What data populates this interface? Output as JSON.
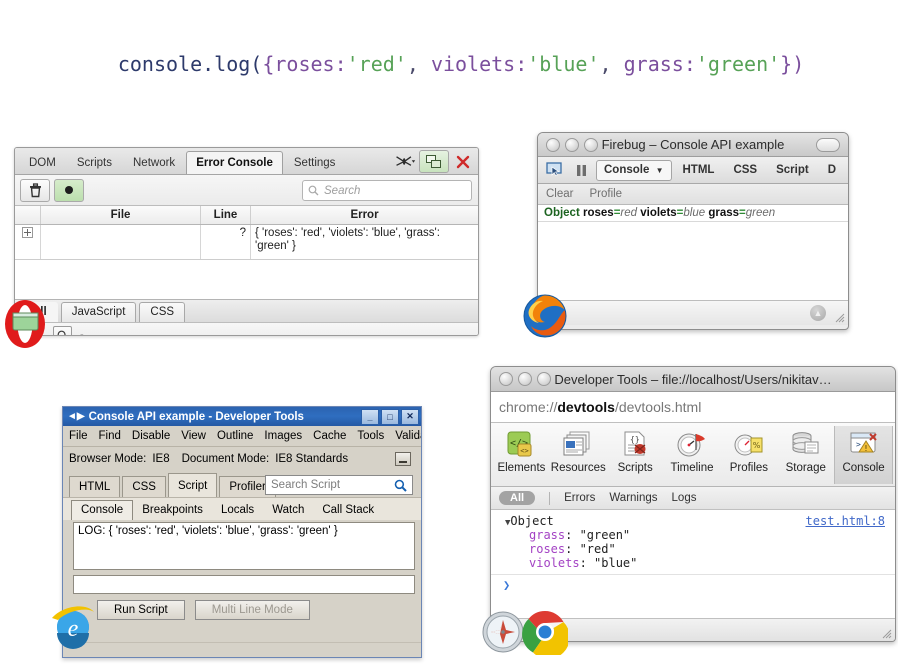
{
  "headline": {
    "segments": [
      {
        "text": "console.log(",
        "cls": "c-fn"
      },
      {
        "text": "{roses:",
        "cls": "c-key"
      },
      {
        "text": "'red'",
        "cls": "c-str"
      },
      {
        "text": ", ",
        "cls": "c-punc"
      },
      {
        "text": "violets:",
        "cls": "c-key"
      },
      {
        "text": "'blue'",
        "cls": "c-str"
      },
      {
        "text": ", ",
        "cls": "c-punc"
      },
      {
        "text": "grass:",
        "cls": "c-key"
      },
      {
        "text": "'green'",
        "cls": "c-str"
      },
      {
        "text": "})",
        "cls": "c-key"
      }
    ],
    "full_text": "console.log({roses:'red', violets:'blue', grass:'green'})"
  },
  "opera": {
    "tabs": [
      {
        "label": "DOM",
        "active": false
      },
      {
        "label": "Scripts",
        "active": false
      },
      {
        "label": "Network",
        "active": false
      },
      {
        "label": "Error Console",
        "active": true
      },
      {
        "label": "Settings",
        "active": false
      }
    ],
    "window_tools": {
      "dragonfly": "dragonfly-icon",
      "detach": "detach-window-icon",
      "close": "close-icon"
    },
    "toolbar": {
      "clear": "trash-icon",
      "record": "record-icon"
    },
    "search": {
      "placeholder": "Search",
      "value": ""
    },
    "columns": [
      "",
      "File",
      "Line",
      "Error"
    ],
    "rows": [
      {
        "expander": "+",
        "file": "",
        "line": "?",
        "error": "{ 'roses': 'red', 'violets': 'blue', 'grass': 'green' }"
      }
    ],
    "filter_tabs": [
      {
        "label": "All",
        "active": true
      },
      {
        "label": "JavaScript",
        "active": false
      },
      {
        "label": "CSS",
        "active": false
      }
    ],
    "statusbar": {
      "magnifier": "magnifier-icon",
      "dash": "-"
    },
    "logo": "opera-logo"
  },
  "firebug": {
    "title": "Firebug – Console API example",
    "toolbar_icons": {
      "inspect": "inspect-cursor-icon",
      "pause": "pause-icon"
    },
    "tabs": [
      {
        "label": "Console",
        "active": true,
        "has_caret": true
      },
      {
        "label": "HTML",
        "active": false,
        "has_caret": false
      },
      {
        "label": "CSS",
        "active": false,
        "has_caret": false
      },
      {
        "label": "Script",
        "active": false,
        "has_caret": false
      },
      {
        "label": "D",
        "active": false,
        "has_caret": false
      }
    ],
    "subbar": [
      "Clear",
      "Profile"
    ],
    "log": {
      "object_label": "Object",
      "props": [
        {
          "key": "roses",
          "value": "red"
        },
        {
          "key": "violets",
          "value": "blue"
        },
        {
          "key": "grass",
          "value": "green"
        }
      ]
    },
    "logo": "firefox-logo"
  },
  "ie": {
    "title": "Console API example - Developer Tools",
    "window_buttons": [
      "_",
      "□",
      "✕"
    ],
    "menu": [
      "File",
      "Find",
      "Disable",
      "View",
      "Outline",
      "Images",
      "Cache",
      "Tools",
      "Validate"
    ],
    "mode": {
      "browser_label": "Browser Mode:",
      "browser_value": "IE8",
      "document_label": "Document Mode:",
      "document_value": "IE8 Standards"
    },
    "tabs": [
      {
        "label": "HTML",
        "active": false
      },
      {
        "label": "CSS",
        "active": false
      },
      {
        "label": "Script",
        "active": true
      },
      {
        "label": "Profiler",
        "active": false
      }
    ],
    "search": {
      "placeholder": "Search Script",
      "value": ""
    },
    "subtabs": [
      {
        "label": "Console",
        "active": true
      },
      {
        "label": "Breakpoints",
        "active": false
      },
      {
        "label": "Locals",
        "active": false
      },
      {
        "label": "Watch",
        "active": false
      },
      {
        "label": "Call Stack",
        "active": false
      }
    ],
    "console_line": "LOG: { 'roses': 'red', 'violets': 'blue', 'grass': 'green' }",
    "input_value": "",
    "buttons": [
      {
        "label": "Run Script",
        "disabled": false
      },
      {
        "label": "Multi Line Mode",
        "disabled": true
      }
    ],
    "logo": "ie-logo"
  },
  "chrome": {
    "title": "Developer Tools – file://localhost/Users/nikitav…",
    "url": {
      "prefix": "chrome://",
      "bold": "devtools",
      "suffix": "/devtools.html"
    },
    "panels": [
      {
        "label": "Elements",
        "icon": "elements-icon",
        "active": false
      },
      {
        "label": "Resources",
        "icon": "resources-icon",
        "active": false
      },
      {
        "label": "Scripts",
        "icon": "scripts-icon",
        "active": false
      },
      {
        "label": "Timeline",
        "icon": "timeline-icon",
        "active": false
      },
      {
        "label": "Profiles",
        "icon": "profiles-icon",
        "active": false
      },
      {
        "label": "Storage",
        "icon": "storage-icon",
        "active": false
      },
      {
        "label": "Console",
        "icon": "console-icon",
        "active": true
      }
    ],
    "filters": [
      {
        "label": "All",
        "active": true
      },
      {
        "label": "Errors",
        "active": false
      },
      {
        "label": "Warnings",
        "active": false
      },
      {
        "label": "Logs",
        "active": false
      }
    ],
    "log": {
      "object_label": "Object",
      "source": "test.html:8",
      "props": [
        {
          "key": "grass",
          "value": "\"green\""
        },
        {
          "key": "roses",
          "value": "\"red\""
        },
        {
          "key": "violets",
          "value": "\"blue\""
        }
      ]
    },
    "prompt": "❯",
    "logos": [
      "safari-logo",
      "chrome-logo"
    ]
  },
  "colors": {
    "code_function": "#2d3a6b",
    "code_key": "#7b4f9d",
    "code_string": "#57a257",
    "firebug_green": "#1c6320",
    "chrome_prop_key": "#a342c4",
    "chrome_link": "#4169c9",
    "ie_title_blue": "#2f6ec0"
  }
}
